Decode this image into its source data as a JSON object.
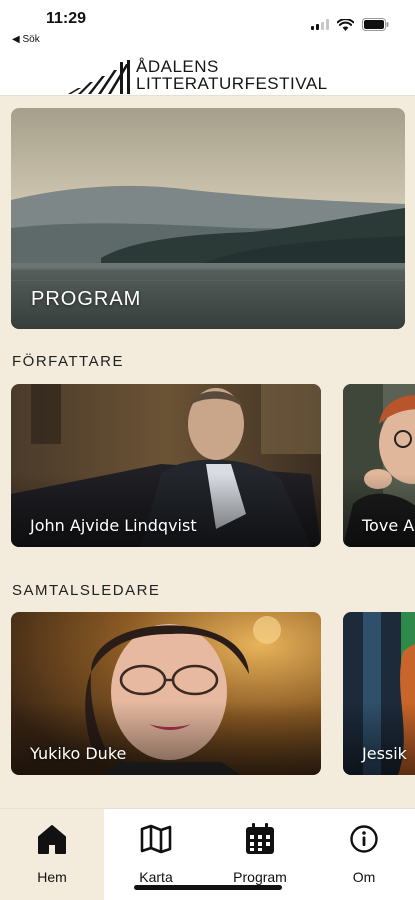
{
  "status_bar": {
    "time": "11:29",
    "back_label": "◀ Sök"
  },
  "header": {
    "logo_line1": "ÅDALENS",
    "logo_line2": "LITTERATURFESTIVAL"
  },
  "program_card": {
    "label": "PROGRAM"
  },
  "authors": {
    "title": "FÖRFATTARE",
    "items": [
      {
        "name": "John Ajvide Lindqvist"
      },
      {
        "name": "Tove A"
      }
    ]
  },
  "moderators": {
    "title": "SAMTALSLEDARE",
    "items": [
      {
        "name": "Yukiko Duke"
      },
      {
        "name": "Jessik"
      }
    ]
  },
  "tab_bar": {
    "tabs": [
      {
        "label": "Hem",
        "icon": "home-icon",
        "active": true
      },
      {
        "label": "Karta",
        "icon": "map-icon",
        "active": false
      },
      {
        "label": "Program",
        "icon": "calendar-icon",
        "active": false
      },
      {
        "label": "Om",
        "icon": "info-icon",
        "active": false
      }
    ]
  },
  "colors": {
    "background": "#f3ecdd",
    "tab_active": "#f3ecdd",
    "text": "#1b1b1b"
  }
}
